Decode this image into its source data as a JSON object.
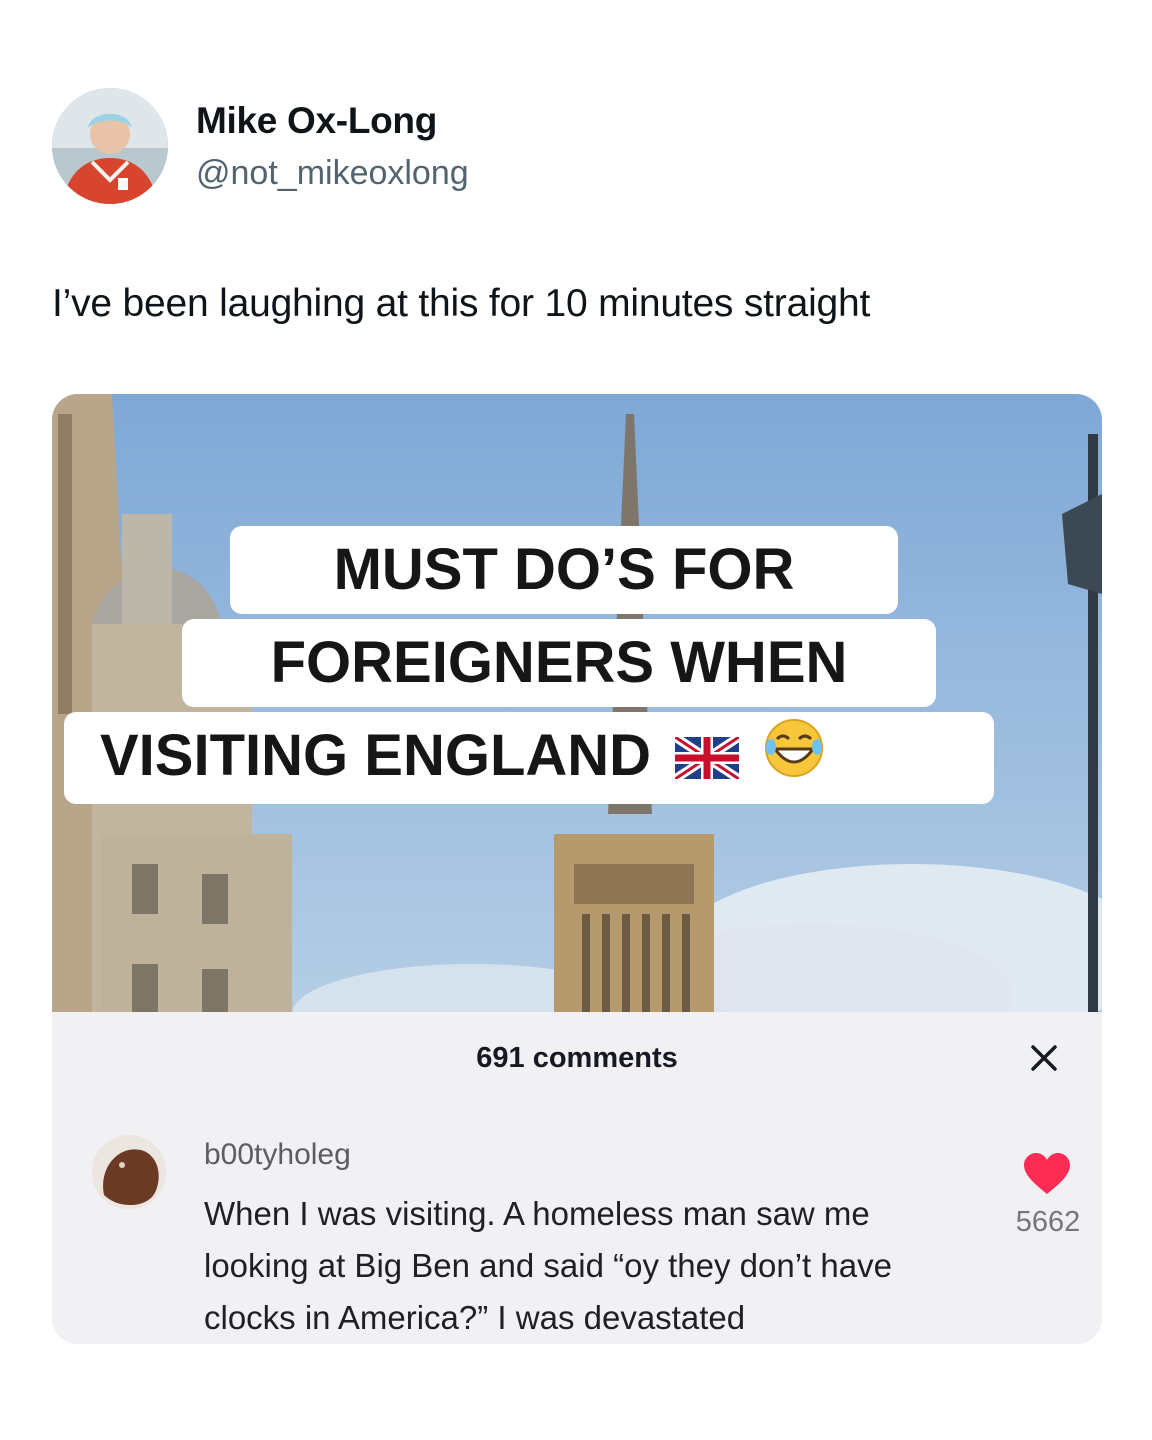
{
  "author": {
    "name": "Mike Ox-Long",
    "handle": "@not_mikeoxlong"
  },
  "tweet": {
    "text": "I’ve been laughing at this for 10 minutes straight"
  },
  "media": {
    "caption_lines": [
      "MUST DO’S FOR",
      "FOREIGNERS WHEN",
      "VISITING  ENGLAND"
    ],
    "caption_emoji": [
      "uk-flag-icon",
      "laughing-emoji-icon"
    ],
    "comments_header": "691 comments",
    "comment": {
      "username": "b00tyholeg",
      "text": "When I was visiting. A homeless man saw me looking at Big Ben and said “oy they don’t have clocks in America?” I was devastated",
      "likes": "5662"
    }
  },
  "colors": {
    "like_heart": "#fe2c55",
    "sky": "#8fb3d9"
  }
}
